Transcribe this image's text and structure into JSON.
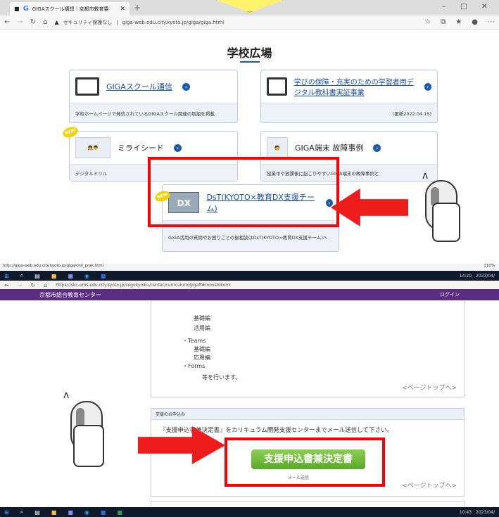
{
  "top_browser": {
    "tab_title": "GIGAスクール構想｜京都市教育委",
    "security_label": "セキュリティ保護なし",
    "url": "giga-web.edu.city.kyoto.jp/giga/giga.html",
    "status_url": "http://giga-web.edu.city.kyoto.jp/giga/chil_prak.html",
    "zoom": "110%"
  },
  "page": {
    "title": "学校広場",
    "cards": [
      {
        "title": "GIGAスクール通信",
        "desc": "学校ホームページで発信されているGIGAスクール関連の取組を掲載"
      },
      {
        "title": "学びの保障・充実のための学習者用デジタル教科書実証事業",
        "desc": "(更新2022.04.15)"
      },
      {
        "title": "ミライシード",
        "desc": "デジタルドリル",
        "badge": "NEW"
      },
      {
        "title": "GIGA端末 故障事例",
        "desc": "授業中や放課後に起こりやすいGIGA端末の故障事例と"
      },
      {
        "title": "DsT(KYOTO×教育DX支援チーム)",
        "desc": "GIGA活用の質問やお困りごとの御相談はDsT(KYOTO×教育DX支援チーム)へ",
        "badge": "NEW",
        "logo": "DX"
      }
    ]
  },
  "taskbar_top": {
    "time": "14:20",
    "date": "2023/04/"
  },
  "bottom_browser": {
    "url": "https://skc-oms.edu.city.kyoto.jp/sogokyoiku/center/curriculum/gigaff#moushikomi",
    "site_name": "京都市総合教育センター",
    "login": "ログイン",
    "list": [
      "基礎編",
      "活用編",
      "・Teams",
      "基礎編",
      "応用編",
      "・Forms",
      "等を行います。"
    ],
    "pagetop": "<ページトップへ>",
    "section_head": "支援のお申込み",
    "instruction": "『支援申込書兼決定書』をカリキュラム開発支援センターまでメール送信して下さい。",
    "button": "支援申込書兼決定書",
    "button_caption": "メール送信"
  },
  "taskbar_bottom": {
    "time": "10:43",
    "date": "2023/04/"
  }
}
